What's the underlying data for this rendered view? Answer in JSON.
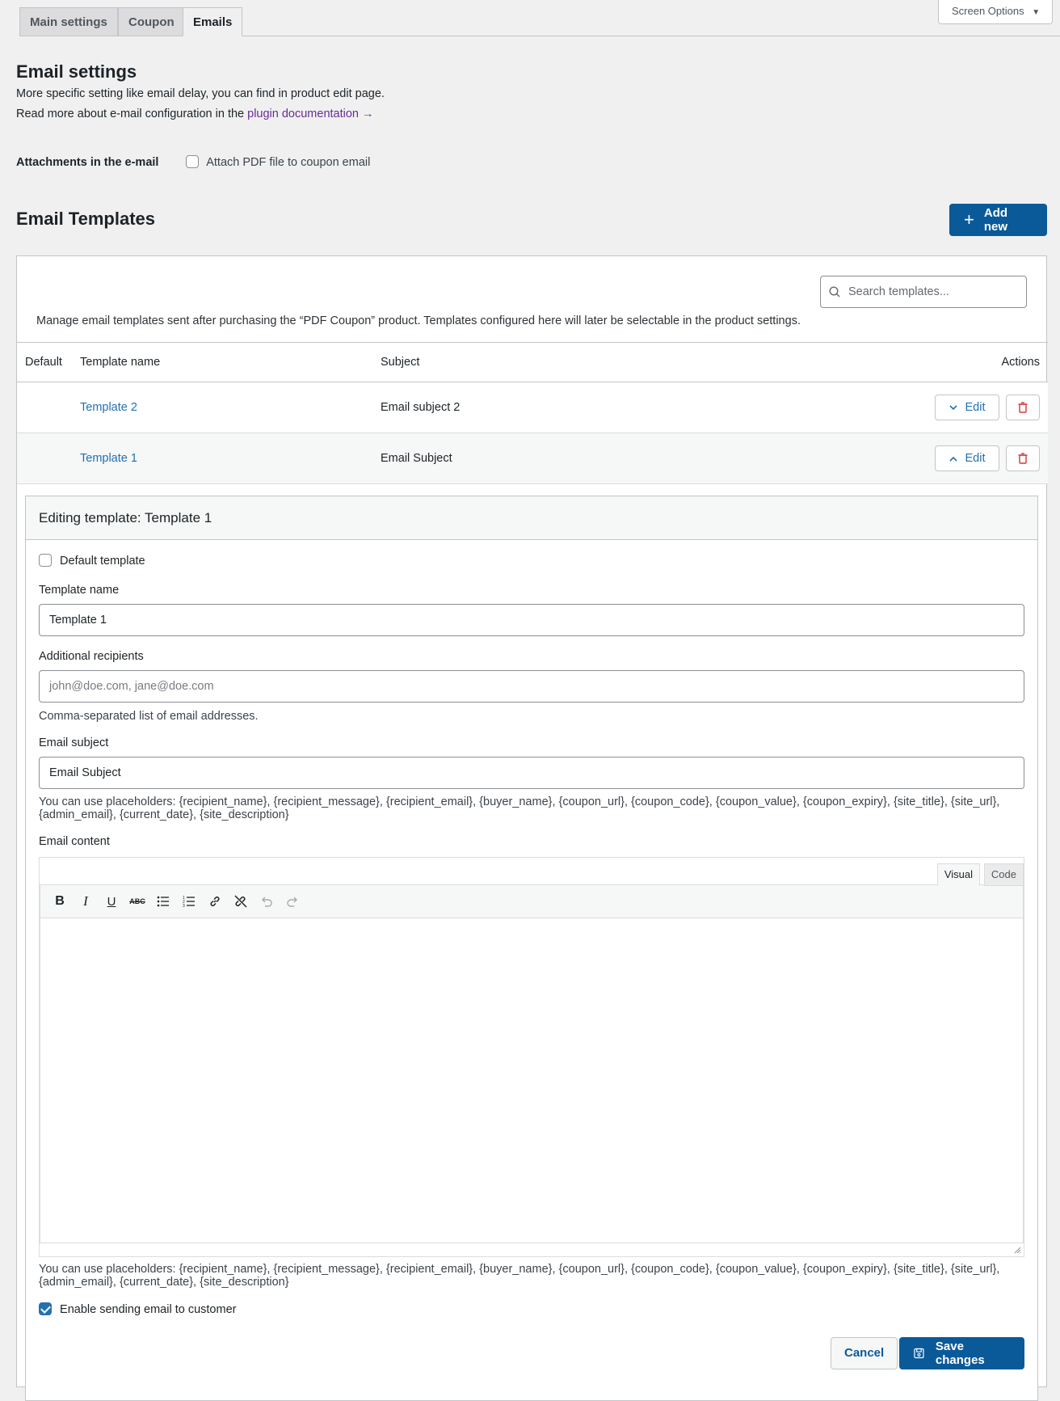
{
  "tabs": [
    "Main settings",
    "Coupon",
    "Emails"
  ],
  "screen_options": "Screen Options",
  "email_settings": {
    "title": "Email settings",
    "line1": "More specific setting like email delay, you can find in product edit page.",
    "line2_prefix": "Read more about e-mail configuration in the ",
    "line2_link": "plugin documentation →"
  },
  "attachments": {
    "label": "Attachments in the e-mail",
    "checkbox_label": "Attach PDF file to coupon email"
  },
  "templates": {
    "title": "Email Templates",
    "add_new": "Add new",
    "search_placeholder": "Search templates...",
    "description": "Manage email templates sent after purchasing the “PDF Coupon” product. Templates configured here will later be selectable in the product settings.",
    "columns": [
      "Default",
      "Template name",
      "Subject",
      "Actions"
    ],
    "rows": [
      {
        "name": "Template 2",
        "subject": "Email subject 2",
        "edit": "Edit"
      },
      {
        "name": "Template 1",
        "subject": "Email Subject",
        "edit": "Edit"
      }
    ]
  },
  "editor": {
    "heading": "Editing template: Template 1",
    "default_template": "Default template",
    "template_name_label": "Template name",
    "template_name_value": "Template 1",
    "recipients_label": "Additional recipients",
    "recipients_placeholder": "john@doe.com, jane@doe.com",
    "recipients_help": "Comma-separated list of email addresses.",
    "subject_label": "Email subject",
    "subject_value": "Email Subject",
    "placeholders_help": "You can use placeholders: {recipient_name}, {recipient_message}, {recipient_email}, {buyer_name}, {coupon_url}, {coupon_code}, {coupon_value}, {coupon_expiry}, {site_title}, {site_url}, {admin_email}, {current_date}, {site_description}",
    "content_label": "Email content",
    "visual_tab": "Visual",
    "code_tab": "Code",
    "enable_sending": "Enable sending email to customer",
    "cancel": "Cancel",
    "save": "Save changes"
  },
  "colors": {
    "primary": "#0a5a99",
    "link": "#2271b1",
    "link_visited": "#6b2c91",
    "danger": "#d63638"
  }
}
